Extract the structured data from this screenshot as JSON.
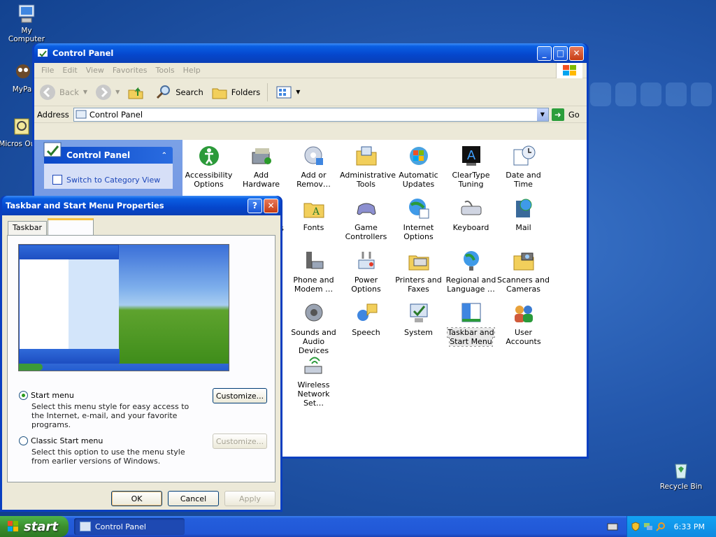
{
  "desktop": {
    "icons": [
      {
        "label": "My Computer"
      },
      {
        "label": "MyPal"
      },
      {
        "label": "Micros Outlo"
      },
      {
        "label": "Recycle Bin"
      }
    ]
  },
  "control_panel": {
    "title": "Control Panel",
    "menu": [
      "File",
      "Edit",
      "View",
      "Favorites",
      "Tools",
      "Help"
    ],
    "toolbar": {
      "back": "Back",
      "search": "Search",
      "folders": "Folders"
    },
    "address_label": "Address",
    "address_value": "Control Panel",
    "go": "Go",
    "taskpane": {
      "title": "Control Panel",
      "link": "Switch to Category View"
    },
    "items": [
      "Accessibility Options",
      "Add Hardware",
      "Add or Remov…",
      "Administrative Tools",
      "Automatic Updates",
      "ClearType Tuning",
      "Date and Time",
      "Fonts",
      "Game Controllers",
      "Internet Options",
      "Keyboard",
      "Mail",
      "Phone and Modem …",
      "Power Options",
      "Printers and Faxes",
      "Regional and Language …",
      "Scanners and Cameras",
      "Sounds and Audio Devices",
      "Speech",
      "System",
      "Taskbar and Start Menu",
      "User Accounts",
      "Wireless Network Set…"
    ],
    "partial_item": "s"
  },
  "dialog": {
    "title": "Taskbar and Start Menu Properties",
    "tabs": [
      "Taskbar",
      ""
    ],
    "option1": {
      "label": "Start menu",
      "desc": "Select this menu style for easy access to the Internet, e-mail, and your favorite programs.",
      "button": "Customize..."
    },
    "option2": {
      "label": "Classic Start menu",
      "desc": "Select this option to use the menu style from earlier versions of Windows.",
      "button": "Customize..."
    },
    "ok": "OK",
    "cancel": "Cancel",
    "apply": "Apply"
  },
  "taskbar": {
    "start": "start",
    "task": "Control Panel",
    "clock": "6:33 PM"
  },
  "colors": {
    "xp_blue": "#0a3fc0",
    "start_green": "#3c8f2e",
    "tray_blue": "#0f8ae1"
  }
}
